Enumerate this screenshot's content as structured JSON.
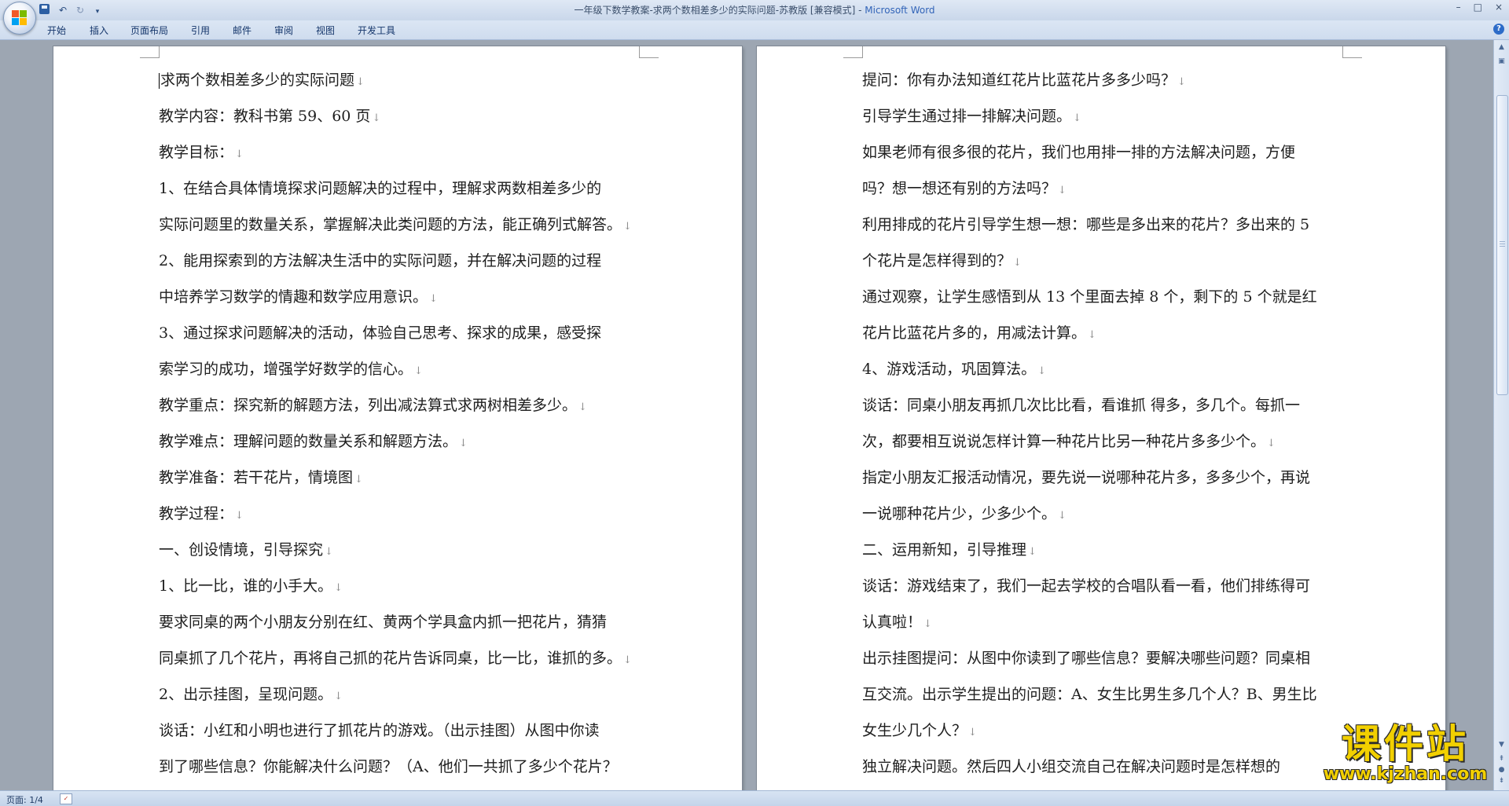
{
  "window": {
    "title": "一年级下数学教案-求两个数相差多少的实际问题-苏教版 [兼容模式]",
    "title_separator": " - ",
    "app_name": "Microsoft Word",
    "controls": [
      "–",
      "□",
      "×"
    ]
  },
  "quick_access": {
    "save_icon": "save-icon",
    "undo_icon": "undo-icon",
    "redo_icon": "redo-icon",
    "customize_icon": "customize-icon"
  },
  "ribbon": {
    "tabs": [
      {
        "label": "开始"
      },
      {
        "label": "插入"
      },
      {
        "label": "页面布局"
      },
      {
        "label": "引用"
      },
      {
        "label": "邮件"
      },
      {
        "label": "审阅"
      },
      {
        "label": "视图"
      },
      {
        "label": "开发工具"
      }
    ]
  },
  "document": {
    "left_page_lines": [
      "求两个数相差多少的实际问题",
      "教学内容：教科书第 59、60 页",
      "教学目标：",
      "1、在结合具体情境探求问题解决的过程中，理解求两数相差多少的",
      "实际问题里的数量关系，掌握解决此类问题的方法，能正确列式解答。",
      "2、能用探索到的方法解决生活中的实际问题，并在解决问题的过程",
      "中培养学习数学的情趣和数学应用意识。",
      "3、通过探求问题解决的活动，体验自己思考、探求的成果，感受探",
      "索学习的成功，增强学好数学的信心。",
      "教学重点：探究新的解题方法，列出减法算式求两树相差多少。",
      "教学难点：理解问题的数量关系和解题方法。",
      "教学准备：若干花片，情境图",
      "教学过程：",
      "一、创设情境，引导探究",
      "1、比一比，谁的小手大。",
      "要求同桌的两个小朋友分别在红、黄两个学具盒内抓一把花片，猜猜",
      "同桌抓了几个花片，再将自己抓的花片告诉同桌，比一比，谁抓的多。",
      "2、出示挂图，呈现问题。",
      "谈话：小红和小明也进行了抓花片的游戏。（出示挂图）从图中你读",
      "到了哪些信息？你能解决什么问题？（A、他们一共抓了多少个花片？"
    ],
    "left_para_end": [
      true,
      true,
      true,
      false,
      true,
      false,
      true,
      false,
      true,
      true,
      true,
      true,
      true,
      true,
      true,
      false,
      true,
      true,
      false,
      false
    ],
    "right_page_lines": [
      "提问：你有办法知道红花片比蓝花片多多少吗？",
      "引导学生通过排一排解决问题。",
      "如果老师有很多很的花片，我们也用排一排的方法解决问题，方便",
      "吗？想一想还有别的方法吗？",
      "利用排成的花片引导学生想一想：哪些是多出来的花片？多出来的 5",
      "个花片是怎样得到的？",
      "通过观察，让学生感悟到从 13 个里面去掉 8 个，剩下的 5 个就是红",
      "花片比蓝花片多的，用减法计算。",
      "4、游戏活动，巩固算法。",
      "谈话：同桌小朋友再抓几次比比看，看谁抓 得多，多几个。每抓一",
      "次，都要相互说说怎样计算一种花片比另一种花片多多少个。",
      "指定小朋友汇报活动情况，要先说一说哪种花片多，多多少个，再说",
      "一说哪种花片少，少多少个。",
      "二、运用新知，引导推理",
      "谈话：游戏结束了，我们一起去学校的合唱队看一看，他们排练得可",
      "认真啦！",
      "出示挂图提问：从图中你读到了哪些信息？要解决哪些问题？同桌相",
      "互交流。出示学生提出的问题：A、女生比男生多几个人？B、男生比",
      "女生少几个人？",
      "独立解决问题。然后四人小组交流自己在解决问题时是怎样想的"
    ],
    "right_para_end": [
      true,
      true,
      false,
      true,
      false,
      true,
      false,
      true,
      true,
      false,
      true,
      false,
      true,
      true,
      false,
      true,
      false,
      false,
      true,
      false
    ],
    "paragraph_mark": "↓"
  },
  "status_bar": {
    "page_info": "页面: 1/4",
    "spell_icon": "spell-check-icon"
  },
  "watermark": {
    "top_text": "课件站",
    "bottom_text": "www.kjzhan.com"
  },
  "colors": {
    "app_name_blue": "#3264b8",
    "watermark_yellow": "#f2d000"
  }
}
